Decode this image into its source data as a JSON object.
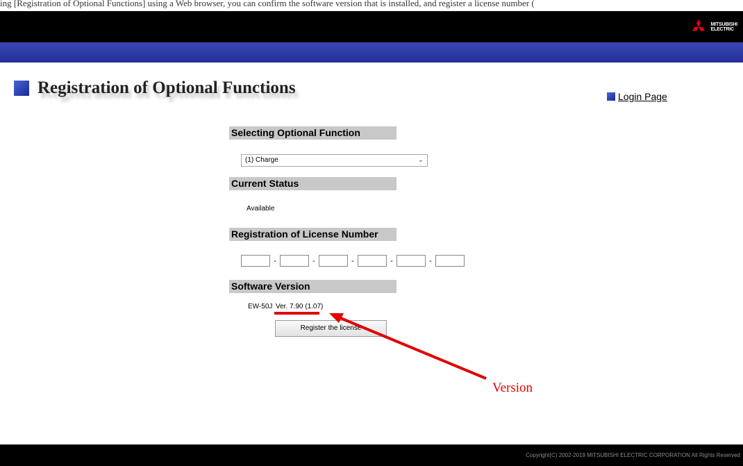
{
  "top_strip": {
    "text": "ing [Registration of Optional Functions] using a Web browser, you can confirm the software version that is installed, and register a license number ("
  },
  "header": {
    "logo": {
      "line1": "MITSUBISHI",
      "line2": "ELECTRIC",
      "icon": "three-diamonds-icon",
      "color": "#e60012"
    },
    "colors": {
      "top": "#000000",
      "band": "#2a35a0"
    }
  },
  "page": {
    "title": "Registration of Optional Functions",
    "login_link": "Login Page"
  },
  "sections": {
    "selecting": {
      "header": "Selecting Optional Function",
      "selected": "(1) Charge"
    },
    "status": {
      "header": "Current Status",
      "value": "Available"
    },
    "license": {
      "header": "Registration of License Number",
      "fields": [
        "",
        "",
        "",
        "",
        "",
        ""
      ],
      "separator": "-"
    },
    "software": {
      "header": "Software Version",
      "product": "EW-50J",
      "version": "Ver. 7.90 (1.07)"
    }
  },
  "register_button": "Register the license",
  "annotation": {
    "label": "Version",
    "color": "#e00000"
  },
  "footer": {
    "copyright": "Copyright(C) 2002-2019 MITSUBISHI ELECTRIC CORPORATION All Rights Reserved"
  }
}
